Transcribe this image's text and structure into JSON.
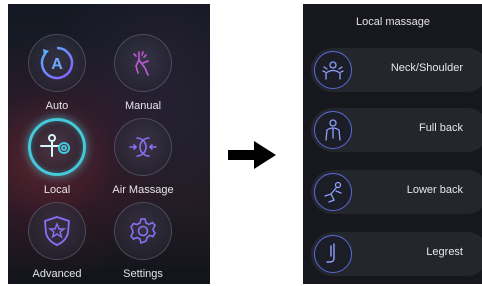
{
  "left_screen": {
    "tiles": [
      {
        "label": "Auto",
        "icon": "auto-icon"
      },
      {
        "label": "Manual",
        "icon": "hand-icon"
      },
      {
        "label": "Local",
        "icon": "local-massage-icon",
        "active": true
      },
      {
        "label": "Air Massage",
        "icon": "air-massage-icon"
      },
      {
        "label": "Advanced",
        "icon": "star-shield-icon"
      },
      {
        "label": "Settings",
        "icon": "gear-icon"
      }
    ]
  },
  "arrow": {
    "icon": "right-arrow-icon"
  },
  "right_screen": {
    "title": "Local massage",
    "items": [
      {
        "label": "Neck/Shoulder",
        "icon": "neck-shoulder-icon"
      },
      {
        "label": "Full back",
        "icon": "full-back-icon"
      },
      {
        "label": "Lower back",
        "icon": "lower-back-icon"
      },
      {
        "label": "Legrest",
        "icon": "legrest-icon"
      }
    ]
  },
  "colors": {
    "accent_cyan": "#45c8d8",
    "icon_purple": "#7e6ef0",
    "icon_blue": "#5a6ad8"
  }
}
